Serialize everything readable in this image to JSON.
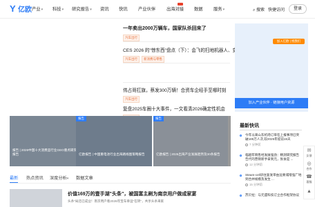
{
  "logo": {
    "text": "亿欧"
  },
  "nav": {
    "items": [
      {
        "label": "产业",
        "has_dropdown": true
      },
      {
        "label": "科技",
        "has_dropdown": true
      },
      {
        "label": "研究报告",
        "has_dropdown": true
      },
      {
        "label": "资讯",
        "has_dropdown": false
      },
      {
        "label": "快讯",
        "has_dropdown": false
      },
      {
        "label": "产业伙伴",
        "has_dropdown": false
      },
      {
        "label": "出海对接",
        "has_dropdown": false
      },
      {
        "label": "数据",
        "has_dropdown": false
      },
      {
        "label": "服务",
        "has_dropdown": true
      }
    ],
    "chevron": "▾",
    "search_label": "搜索",
    "quick_login_label": "快捷访问",
    "login_label": "登录"
  },
  "articles": [
    {
      "title": "一年卖出2000万辆车，国家队杀回来了",
      "tags": [
        "汽车出行"
      ]
    },
    {
      "title": "CES 2026 的\"惊东西\"盘点（下）：会飞的扫地机器人、变色蔬甲",
      "tags": [
        "汽车出行",
        "新消费与零售"
      ]
    },
    {
      "title": "伟占哥扛旗，蔡发300万辆！合资车企经手至哪时刻",
      "tags": [
        "汽车出行"
      ]
    },
    {
      "title": "复盘2025车圈十大事件，一文看清2026确定性机会",
      "tags": [
        "汽车出行"
      ]
    }
  ],
  "right_ad": {
    "badge": "加入亿欧 | 找我们",
    "button": "加入产业伙伴 · 链接用户资源"
  },
  "carousel": {
    "slides": [
      {
        "label": "",
        "text": "报告 | 2026中国十大消费品行业GEO重点研究报告"
      },
      {
        "label": "报告",
        "text": "亿欧报告 | 中国重电池行业出海路线图策略报告"
      },
      {
        "label": "报告",
        "text": "亿欧报告 | 2025出海产业发展趋势及30条报告"
      }
    ]
  },
  "tabs": [
    {
      "label": "最新",
      "active": true
    },
    {
      "label": "热点资讯",
      "active": false
    },
    {
      "label": "深度分析",
      "active": false
    },
    {
      "label": "数据文章",
      "active": false
    }
  ],
  "bottom_article": {
    "title": "价值169万的壹手湖\"头条\"，被国富主刷为南京用户做成家宴",
    "desc": "头条\"局还已成业！南京用户看2026年宝车幸运\"在转\"，共享头条来家"
  },
  "flash": {
    "heading": "最新快讯",
    "items": [
      {
        "text": "今年以来山东机场订单在上报事项已突破185万人次,较2025年提前15天",
        "time": "7 分钟前"
      },
      {
        "text": "临越年销售经发展强劲：精测研究报告告代的营销新手拿到元，张食是 ...",
        "time": "12 分钟前"
      },
      {
        "text": "Steam-cell诉往复发审由远要城增强厂地到合并规模及发生 ...",
        "time": "15 分钟前"
      },
      {
        "text": "苏贝拉：与元盛科技订立合作框架协议",
        "time": ""
      }
    ]
  },
  "side_bar": [
    {
      "icon": "✉",
      "label": "反馈"
    },
    {
      "icon": "◎",
      "label": "合作"
    },
    {
      "icon": "☎",
      "label": "客服"
    },
    {
      "icon": "▲",
      "label": ""
    }
  ]
}
